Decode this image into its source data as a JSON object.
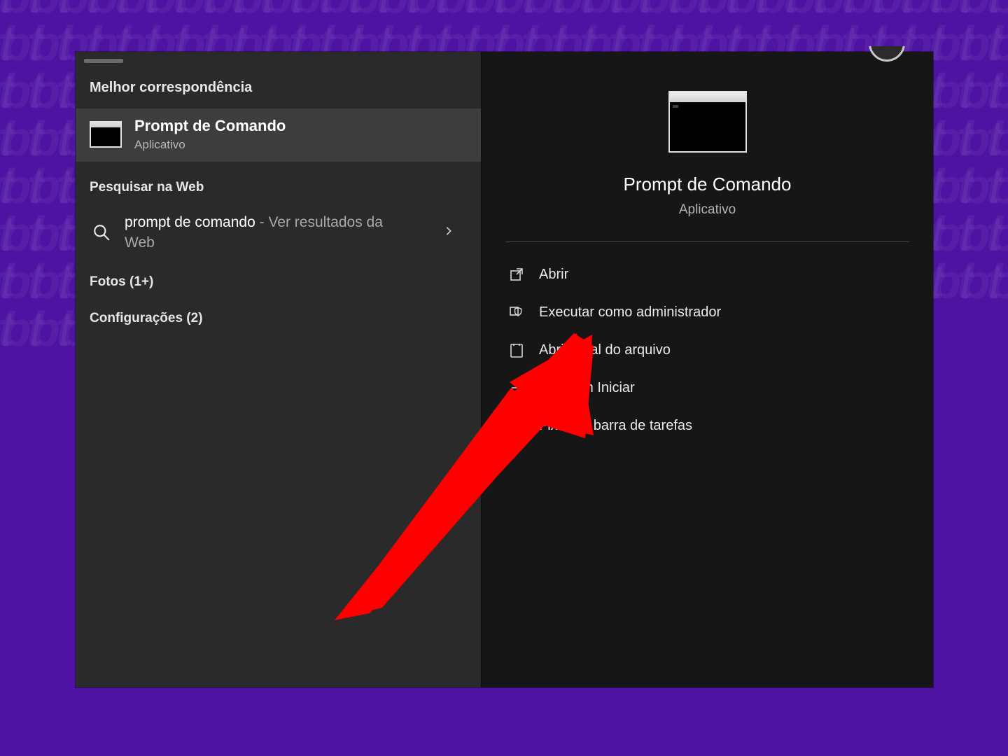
{
  "left": {
    "best_match_header": "Melhor correspondência",
    "best_match": {
      "title": "Prompt de Comando",
      "subtitle": "Aplicativo"
    },
    "web_header": "Pesquisar na Web",
    "web_item": {
      "query": "prompt de comando",
      "suffix": " - Ver resultados da Web"
    },
    "categories": {
      "photos": "Fotos (1+)",
      "settings": "Configurações (2)"
    }
  },
  "right": {
    "title": "Prompt de Comando",
    "subtitle": "Aplicativo",
    "actions": {
      "open": "Abrir",
      "run_admin": "Executar como administrador",
      "open_location": "Abrir local do arquivo",
      "pin_start": "Fixar em Iniciar",
      "pin_taskbar": "Fixar na barra de tarefas"
    }
  }
}
